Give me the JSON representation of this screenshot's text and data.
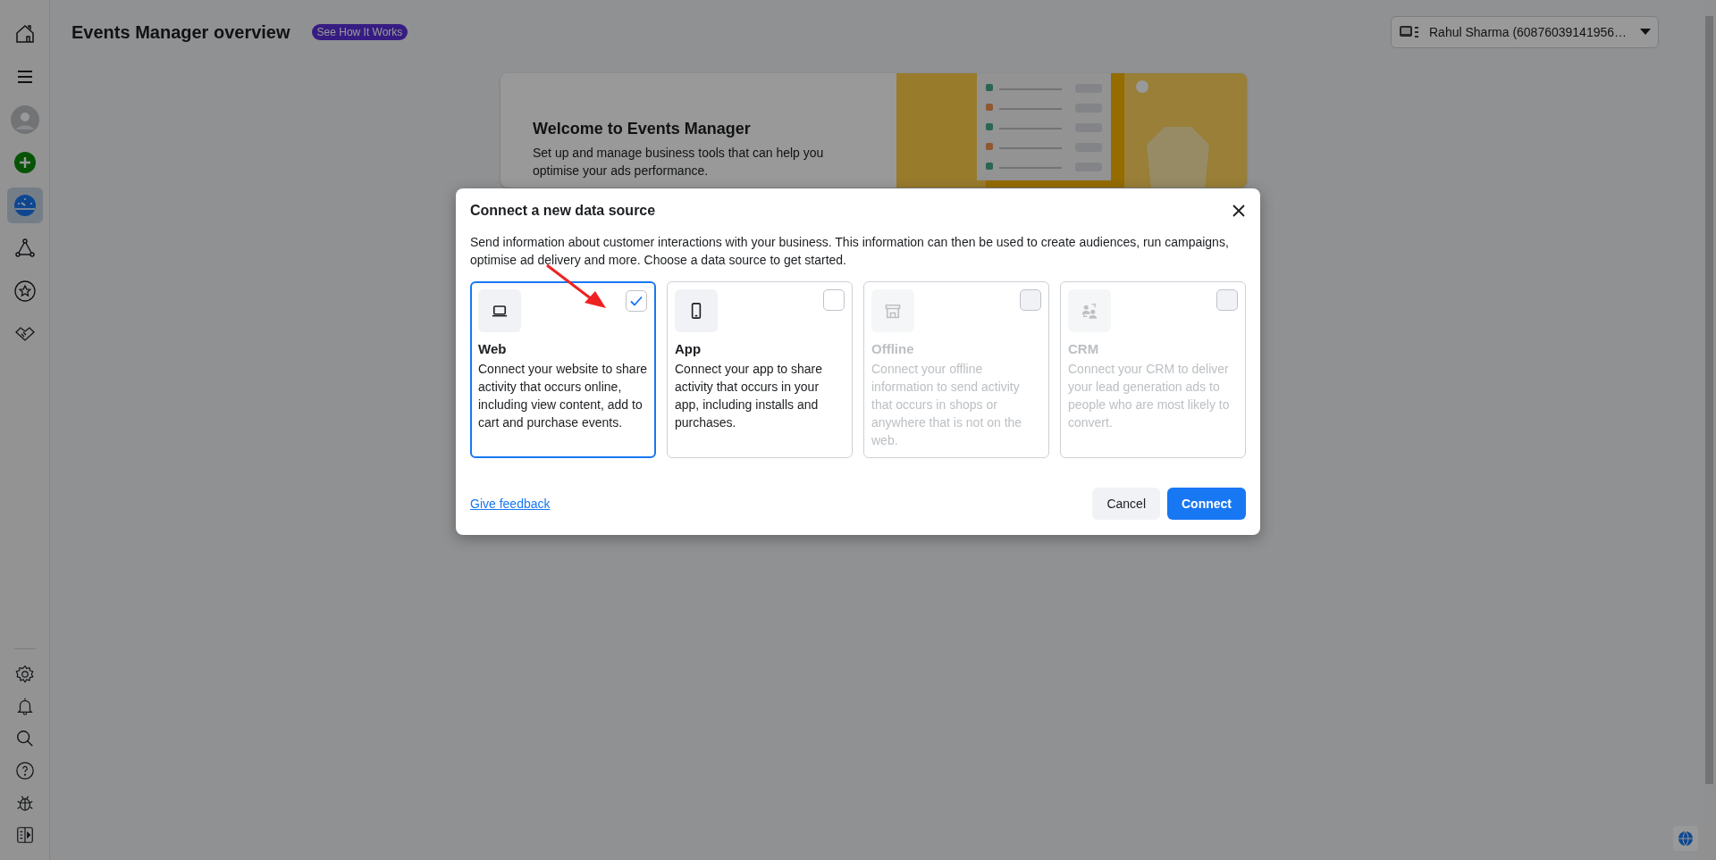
{
  "header": {
    "title": "Events Manager overview",
    "badge": "See How It Works",
    "account": "Rahul Sharma (60876039141956…"
  },
  "sidebar": {
    "top_items": [
      {
        "kind": "home",
        "selected": false
      },
      {
        "kind": "menu",
        "selected": false
      },
      {
        "kind": "avatar",
        "selected": false
      },
      {
        "kind": "add",
        "selected": false
      },
      {
        "kind": "gauge",
        "selected": true
      },
      {
        "kind": "network",
        "selected": false
      },
      {
        "kind": "star",
        "selected": false
      },
      {
        "kind": "handshake",
        "selected": false
      }
    ],
    "bottom_items": [
      {
        "kind": "settings"
      },
      {
        "kind": "bell"
      },
      {
        "kind": "search"
      },
      {
        "kind": "help"
      },
      {
        "kind": "bug"
      },
      {
        "kind": "panel"
      }
    ]
  },
  "welcome": {
    "title": "Welcome to Events Manager",
    "text": "Set up and manage business tools that can help you optimise your ads performance."
  },
  "dialog": {
    "title": "Connect a new data source",
    "description": "Send information about customer interactions with your business. This information can then be used to create audiences, run campaigns, optimise ad delivery and more. Choose a data source to get started.",
    "sources": [
      {
        "kind": "web",
        "name": "Web",
        "text": "Connect your website to share activity that occurs online, including view content, add to cart and purchase events.",
        "selected": true,
        "disabled": false
      },
      {
        "kind": "app",
        "name": "App",
        "text": "Connect your app to share activity that occurs in your app, including installs and purchases.",
        "selected": false,
        "disabled": false
      },
      {
        "kind": "offline",
        "name": "Offline",
        "text": "Connect your offline information to send activity that occurs in shops or anywhere that is not on the web.",
        "selected": false,
        "disabled": true
      },
      {
        "kind": "crm",
        "name": "CRM",
        "text": "Connect your CRM to deliver your lead generation ads to people who are most likely to convert.",
        "selected": false,
        "disabled": true
      }
    ],
    "feedback_link": "Give feedback",
    "cancel": "Cancel",
    "connect": "Connect"
  }
}
